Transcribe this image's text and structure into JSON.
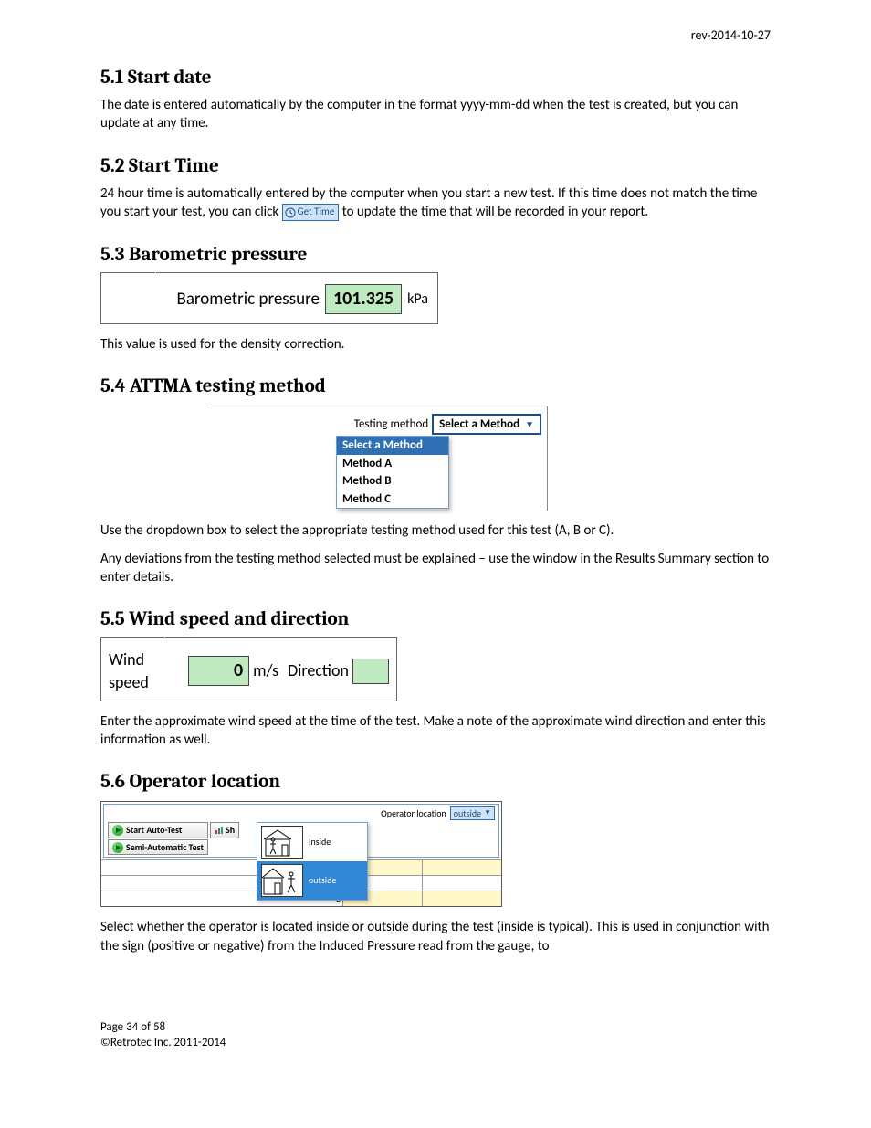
{
  "rev": "rev-2014-10-27",
  "s51": {
    "heading": "5.1  Start date",
    "p1": "The date is entered automatically by the computer in the format yyyy-mm-dd when the test is created, but you can update at any time."
  },
  "s52": {
    "heading": "5.2  Start Time",
    "p1a": "24 hour time is automatically entered by the computer when you start a new test.  If this time does not match the time you start your test,  you can click ",
    "btn": "Get Time",
    "p1b": " to update the time that will be recorded in your report."
  },
  "s53": {
    "heading": "5.3  Barometric pressure",
    "label": "Barometric pressure",
    "value": "101.325",
    "unit": "kPa",
    "p1": "This value is used for the density correction."
  },
  "s54": {
    "heading": "5.4  ATTMA testing method",
    "label": "Testing method",
    "selected": "Select a Method",
    "options": [
      "Select a Method",
      "Method A",
      "Method B",
      "Method C"
    ],
    "p1": "Use the dropdown box to select the appropriate testing method used for this test (A, B or C).",
    "p2": "Any deviations from the testing method selected must be explained – use the window in the Results Summary section to enter details."
  },
  "s55": {
    "heading": "5.5  Wind speed and direction",
    "label": "Wind speed",
    "value": "0",
    "unit": "m/s",
    "dir_label": "Direction",
    "dir_value": "",
    "p1": "Enter the approximate wind speed at the time of the test.  Make a note of the approximate wind direction and enter this information as well."
  },
  "s56": {
    "heading": "5.6  Operator location",
    "label": "Operator location",
    "selected": "outside",
    "btn_auto": "Start Auto-Test",
    "btn_semi": "Semi-Automatic Test",
    "btn_sh": "Sh",
    "opt_inside": "Inside",
    "opt_outside": "outside",
    "row_b": "B",
    "p1": "Select whether the operator is located inside or outside during the test (inside is typical).  This is used in conjunction with the sign (positive or negative) from the Induced Pressure read from the gauge, to"
  },
  "footer": {
    "page": "Page 34 of 58",
    "copyright": "©Retrotec Inc. 2011-2014"
  }
}
